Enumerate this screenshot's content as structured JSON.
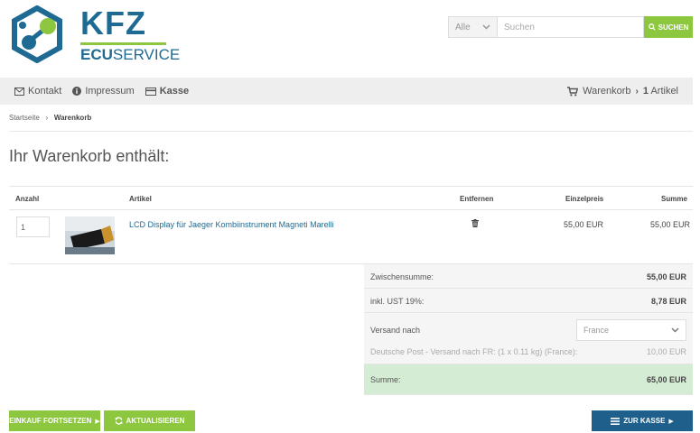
{
  "brand": {
    "name_top": "KFZ",
    "name_bottom_bold": "ECU",
    "name_bottom_rest": "SERVICE",
    "primary_color": "#1e6a93",
    "accent_color": "#8dc63f"
  },
  "search": {
    "category": "Alle",
    "placeholder": "Suchen",
    "button_label": "SUCHEN"
  },
  "nav": {
    "contact": "Kontakt",
    "imprint": "Impressum",
    "checkout": "Kasse",
    "cart_label": "Warenkorb",
    "cart_count": "1",
    "cart_unit": "Artikel"
  },
  "breadcrumb": {
    "home": "Startseite",
    "current": "Warenkorb"
  },
  "page_title": "Ihr Warenkorb enthält:",
  "table": {
    "headers": {
      "qty": "Anzahl",
      "article": "Artikel",
      "remove": "Entfernen",
      "unit_price": "Einzelpreis",
      "sum": "Summe"
    },
    "rows": [
      {
        "qty": "1",
        "product": "LCD Display für Jaeger Kombiinstrument Magneti Marelli",
        "unit_price": "55,00 EUR",
        "total": "55,00 EUR"
      }
    ]
  },
  "totals": {
    "subtotal_label": "Zwischensumme:",
    "subtotal_value": "55,00 EUR",
    "tax_label": "inkl. UST 19%:",
    "tax_value": "8,78 EUR",
    "shipping_label": "Versand nach",
    "shipping_country": "France",
    "shipping_method": "Deutsche Post - Versand nach FR: (1 x 0.11 kg) (France):",
    "shipping_value": "10,00 EUR",
    "total_label": "Summe:",
    "total_value": "65,00 EUR"
  },
  "buttons": {
    "continue": "EINKAUF FORTSETZEN",
    "update": "AKTUALISIEREN",
    "checkout": "ZUR KASSE"
  }
}
